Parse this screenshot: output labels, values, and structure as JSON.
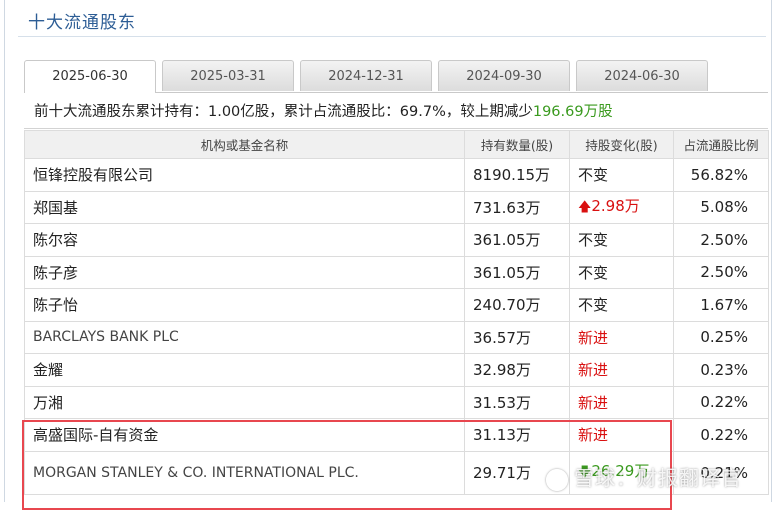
{
  "page_title": "十大流通股东",
  "tabs": [
    {
      "label": "2025-06-30",
      "active": true
    },
    {
      "label": "2025-03-31",
      "active": false
    },
    {
      "label": "2024-12-31",
      "active": false
    },
    {
      "label": "2024-09-30",
      "active": false
    },
    {
      "label": "2024-06-30",
      "active": false
    }
  ],
  "summary": {
    "prefix": "前十大流通股东累计持有：1.00亿股，累计占流通股比：69.7%，较上期减少",
    "change": "196.69万股"
  },
  "table": {
    "headers": [
      "机构或基金名称",
      "持有数量(股)",
      "持股变化(股)",
      "占流通股比例"
    ],
    "rows": [
      {
        "name": "恒锋控股有限公司",
        "amount": "8190.15万",
        "change": "不变",
        "change_type": "same",
        "pct": "56.82%"
      },
      {
        "name": "郑国基",
        "amount": "731.63万",
        "change": "2.98万",
        "change_type": "up",
        "pct": "5.08%"
      },
      {
        "name": "陈尔容",
        "amount": "361.05万",
        "change": "不变",
        "change_type": "same",
        "pct": "2.50%"
      },
      {
        "name": "陈子彦",
        "amount": "361.05万",
        "change": "不变",
        "change_type": "same",
        "pct": "2.50%"
      },
      {
        "name": "陈子怡",
        "amount": "240.70万",
        "change": "不变",
        "change_type": "same",
        "pct": "1.67%"
      },
      {
        "name": "BARCLAYS BANK PLC",
        "amount": "36.57万",
        "change": "新进",
        "change_type": "new",
        "pct": "0.25%"
      },
      {
        "name": "金耀",
        "amount": "32.98万",
        "change": "新进",
        "change_type": "new",
        "pct": "0.23%"
      },
      {
        "name": "万湘",
        "amount": "31.53万",
        "change": "新进",
        "change_type": "new",
        "pct": "0.22%"
      },
      {
        "name": "高盛国际-自有资金",
        "amount": "31.13万",
        "change": "新进",
        "change_type": "new",
        "pct": "0.22%"
      },
      {
        "name": "MORGAN STANLEY & CO. INTERNATIONAL PLC.",
        "amount": "29.71万",
        "change": "26.29万",
        "change_type": "down",
        "pct": "0.21%"
      }
    ]
  },
  "watermark": "雪球：财报翻译官",
  "colors": {
    "title": "#2d5d95",
    "increase": "#d91010",
    "decrease": "#3a9a1e",
    "highlight": "#e8474f"
  }
}
